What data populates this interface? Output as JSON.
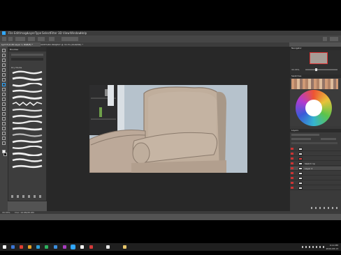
{
  "app": {
    "menu": [
      "File",
      "Edit",
      "Image",
      "Layer",
      "Type",
      "Select",
      "Filter",
      "3D",
      "View",
      "Window",
      "Help"
    ]
  },
  "tabs": [
    {
      "label": "Lyrd 8 (0.26 Layer 1, RGB/8) *"
    },
    {
      "label": "UNTITLED PROJECT @ 33.3% (RGB/8#) *"
    }
  ],
  "brushes": {
    "panel_title": "Brushes",
    "group_label": "Dry Media",
    "stroke_count": 16
  },
  "panels": {
    "navigator_title": "Navigator",
    "swatches_title": "Swatches",
    "layers_title": "Layers",
    "zoom_value": "33.33%"
  },
  "layers": [
    {
      "name": "",
      "visible": true
    },
    {
      "name": "",
      "visible": true
    },
    {
      "name": "",
      "visible": true
    },
    {
      "name": "Sketch 1p",
      "visible": true
    },
    {
      "name": "Layer 2",
      "visible": true,
      "active": true
    },
    {
      "name": "",
      "visible": true
    },
    {
      "name": "",
      "visible": true
    },
    {
      "name": "",
      "visible": true
    },
    {
      "name": "",
      "visible": true
    }
  ],
  "status": {
    "zoom": "33.33%",
    "doc": "Doc: 16.6M/45.6M"
  },
  "taskbar": {
    "time": "9:14 PM",
    "date": "2019-08-13",
    "icon_colors": [
      "#ffffff",
      "#3a77d8",
      "#e03d31",
      "#e8a325",
      "#2d9fd9",
      "#2db35f",
      "#3b8fe0",
      "#a83dbf",
      "#31a8ff",
      "#ffffff",
      "#d43a3a",
      "#e6e6e6",
      "#e8c66a"
    ]
  },
  "colors": {
    "accent": "#31a8ff",
    "canvas_bg": "#282828",
    "panel_bg": "#3d3d3d",
    "chair": "#bfae9d",
    "wall": "#b7c3cd"
  }
}
